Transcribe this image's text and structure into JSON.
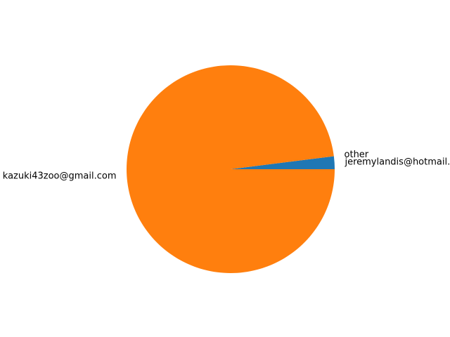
{
  "chart_data": {
    "type": "pie",
    "title": "",
    "labels": [
      "jeremylandis@hotmail.com",
      "other",
      "kazuki43zoo@gmail.com"
    ],
    "values": [
      2,
      0,
      98
    ],
    "colors": [
      "#1f77b4",
      "#2ca02c",
      "#ff7f0e"
    ],
    "start_angle": 0,
    "direction": "counterclockwise"
  }
}
